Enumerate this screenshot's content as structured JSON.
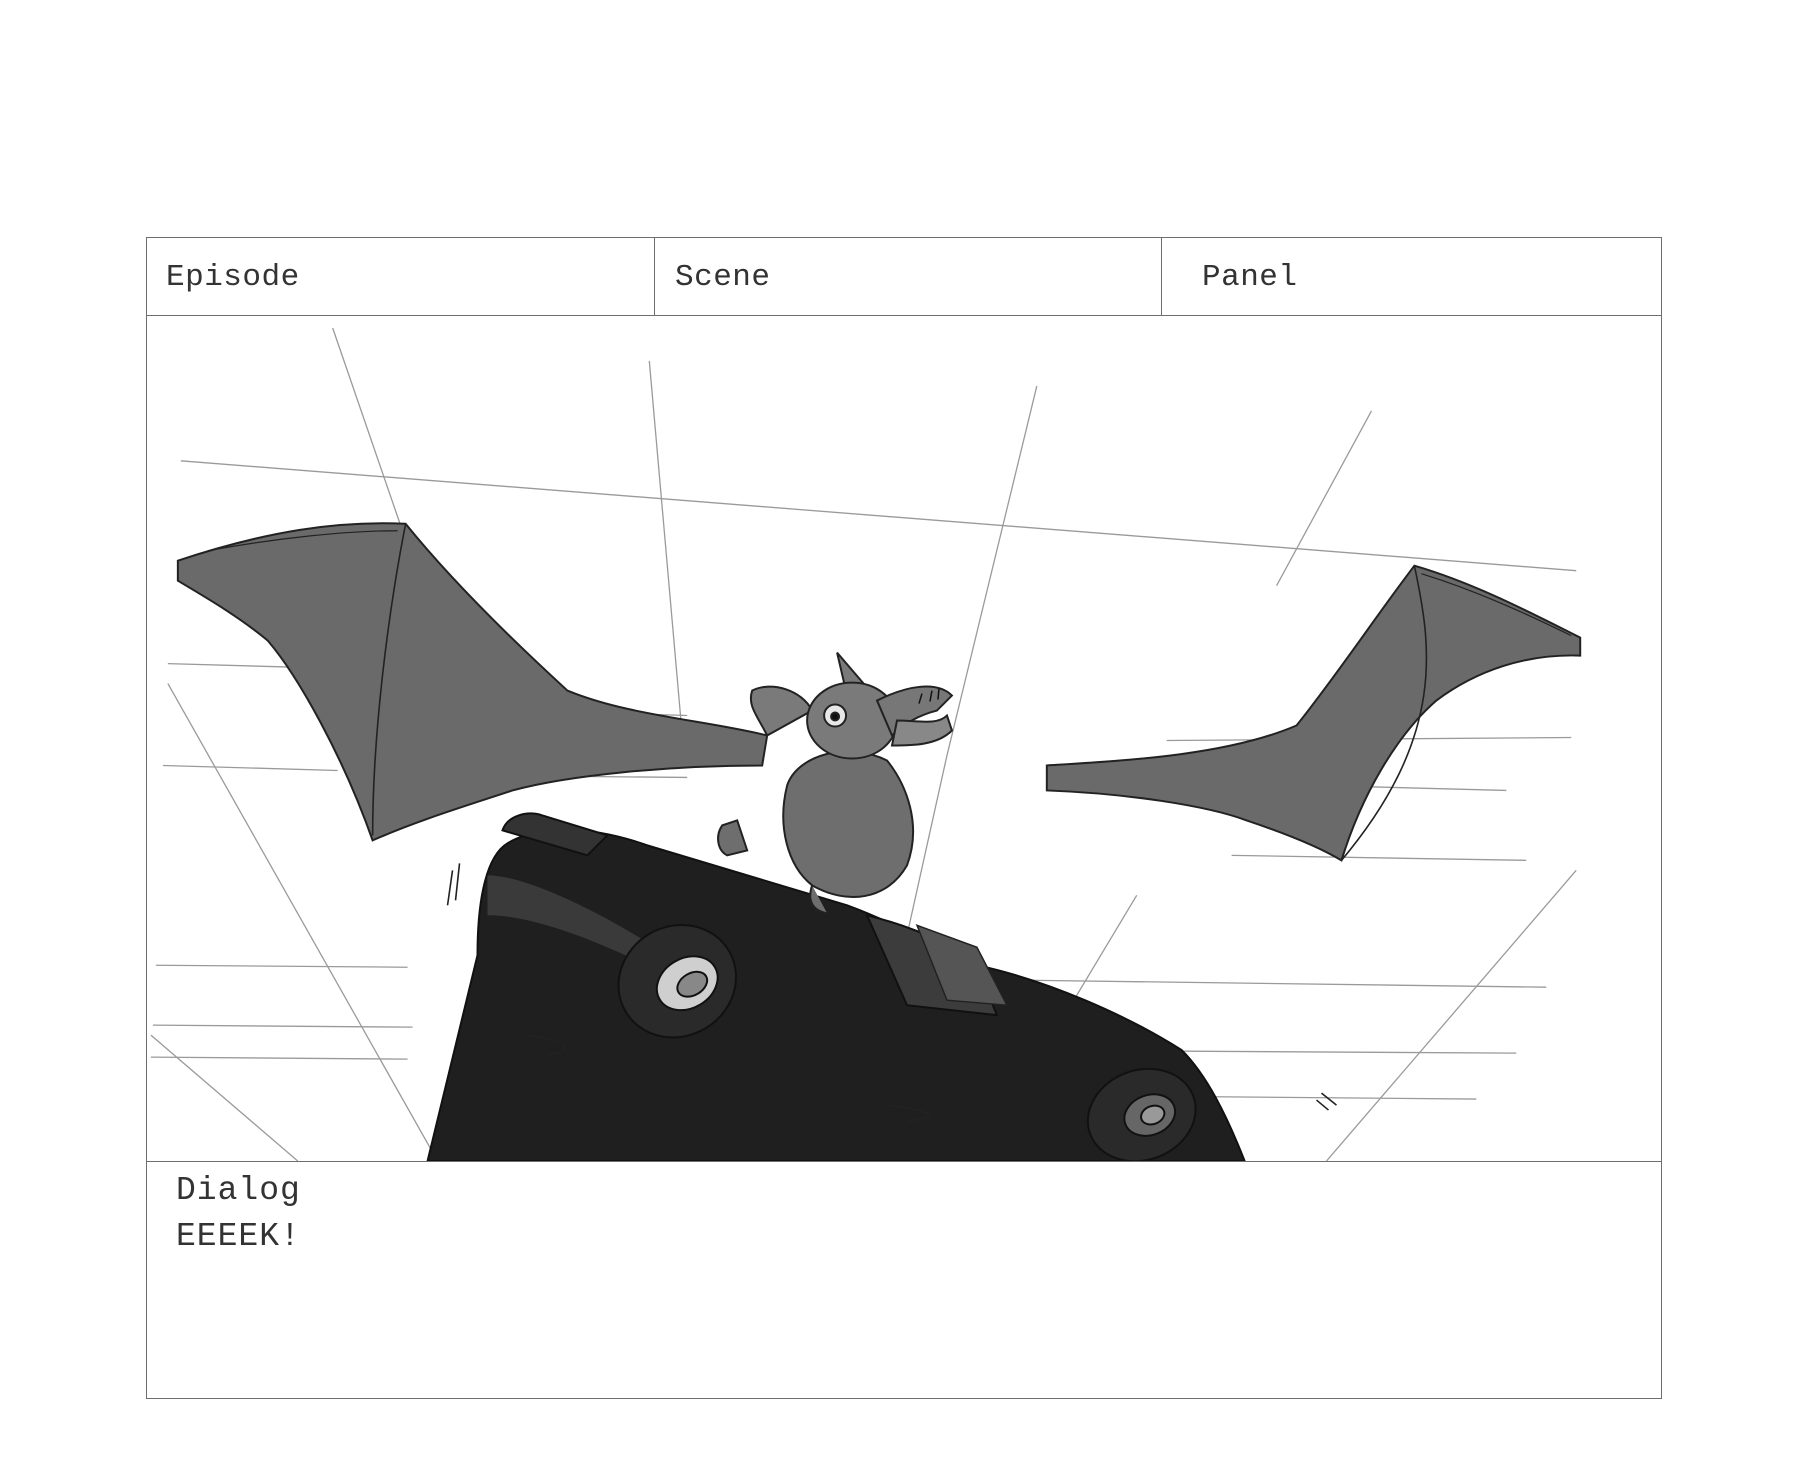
{
  "header": {
    "episode_label": "Episode",
    "scene_label": "Scene",
    "panel_label": "Panel"
  },
  "artwork": {
    "subject": "bat-on-car-sketch",
    "palette": {
      "wing": "#6a6a6a",
      "car": "#1f1f1f",
      "guide_lines": "#9a9a9a",
      "paper": "#ffffff"
    }
  },
  "dialog": {
    "label": "Dialog",
    "text": "EEEEK!"
  }
}
